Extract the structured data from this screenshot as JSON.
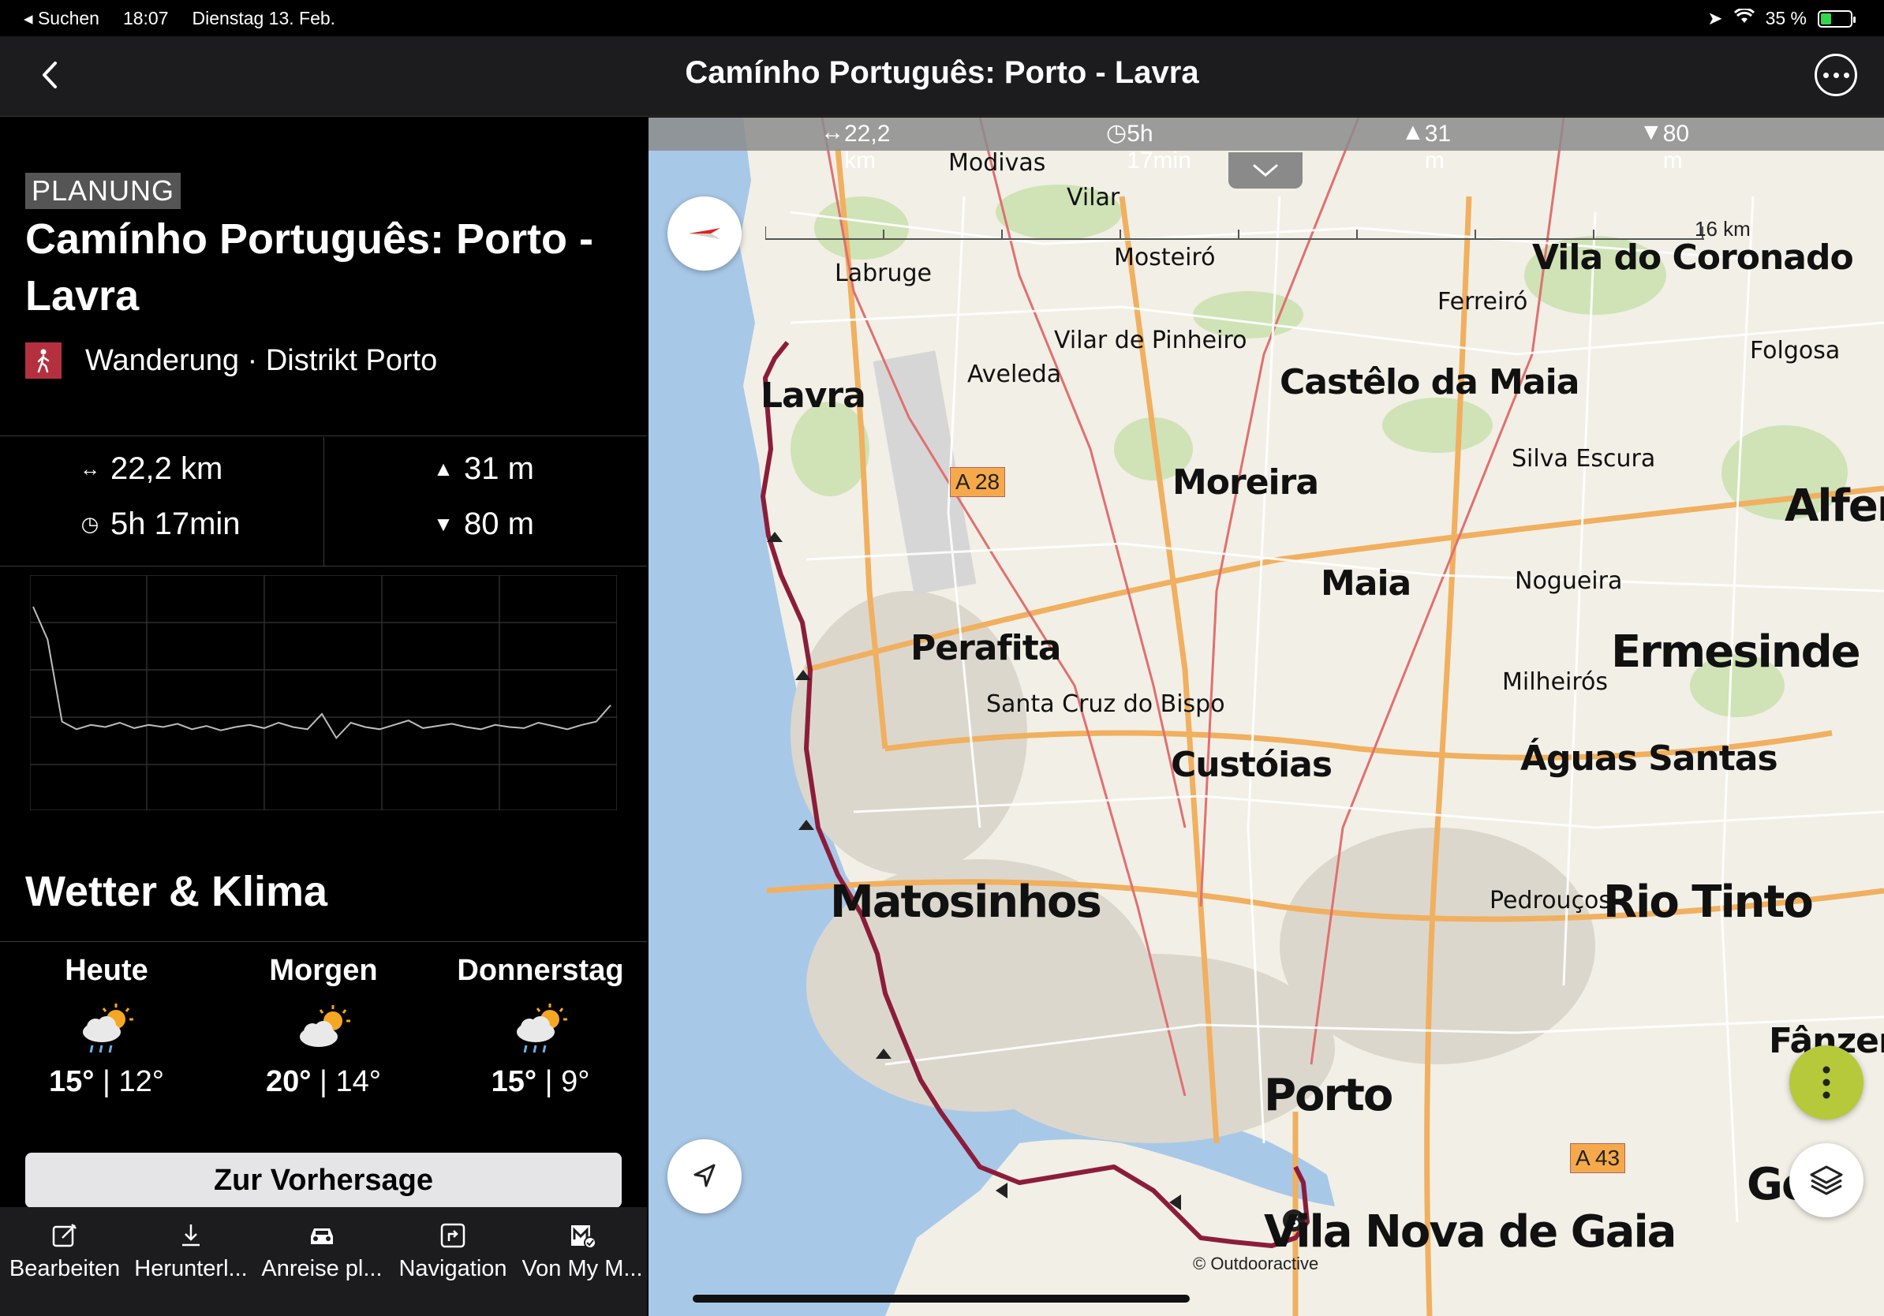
{
  "status": {
    "back_app": "Suchen",
    "time": "18:07",
    "date": "Dienstag 13. Feb.",
    "battery": "35 %",
    "battery_level": 0.35
  },
  "header": {
    "title": "Camínho Português: Porto - Lavra"
  },
  "tour": {
    "badge": "PLANUNG",
    "title": "Camínho Português: Porto - Lavra",
    "subtitle": "Wanderung · Distrikt Porto",
    "distance": "22,2 km",
    "duration": "5h 17min",
    "ascent": "31 m",
    "descent": "80 m"
  },
  "weather": {
    "heading": "Wetter & Klima",
    "days": [
      {
        "name": "Heute",
        "high": "15°",
        "low": "12°",
        "icon": "sun-cloud-rain-icon"
      },
      {
        "name": "Morgen",
        "high": "20°",
        "low": "14°",
        "icon": "sun-cloud-icon"
      },
      {
        "name": "Donnerstag",
        "high": "15°",
        "low": "9°",
        "icon": "sun-cloud-rain-icon"
      }
    ],
    "forecast_button": "Zur Vorhersage"
  },
  "toolbar": {
    "items": [
      {
        "label": "Bearbeiten",
        "icon": "edit-icon"
      },
      {
        "label": "Herunterl...",
        "icon": "download-icon"
      },
      {
        "label": "Anreise pl...",
        "icon": "car-icon"
      },
      {
        "label": "Navigation",
        "icon": "navigation-icon"
      },
      {
        "label": "Von My M...",
        "icon": "map-check-icon"
      }
    ]
  },
  "map": {
    "stats": {
      "distance": "22,2 km",
      "duration": "5h 17min",
      "ascent": "31 m",
      "descent": "80 m"
    },
    "scale": "16 km",
    "copyright": "© Outdooractive",
    "route_color": "#8b1d3a",
    "places": {
      "vila_nova_de_gaia": "Vila Nova de Gaia",
      "porto": "Porto",
      "matosinhos": "Matosinhos",
      "rio_tinto": "Rio Tinto",
      "ermesinde": "Ermesinde",
      "alfer": "Alfer",
      "maia": "Maia",
      "moreira": "Moreira",
      "custoias": "Custóias",
      "perafita": "Perafita",
      "lavra": "Lavra",
      "castelo_da_maia": "Castêlo da Maia",
      "vila_do_coronado": "Vila do Coronado",
      "aguas_santas": "Águas Santas",
      "gondomar": "Gon",
      "fanzeres": "Fânzere",
      "modivas": "Modivas",
      "vilar": "Vilar",
      "labruge": "Labruge",
      "mosteiro": "Mosteiró",
      "ferreiro": "Ferreiró",
      "vilar_de_pinheiro": "Vilar de Pinheiro",
      "aveleda": "Aveleda",
      "folgosa": "Folgosa",
      "silva_escura": "Silva Escura",
      "nogueira": "Nogueira",
      "milheiros": "Milheirós",
      "santa_cruz_do_bispo": "Santa Cruz do Bispo",
      "pedroucos": "Pedrouços"
    },
    "shields": {
      "a28": "A 28",
      "a43": "A 43"
    }
  },
  "elevation_profile": {
    "type": "line",
    "y": [
      150,
      120,
      45,
      38,
      42,
      40,
      44,
      39,
      42,
      40,
      43,
      38,
      41,
      37,
      40,
      42,
      39,
      44,
      40,
      38,
      52,
      30,
      44,
      40,
      38,
      42,
      46,
      39,
      41,
      43,
      40,
      38,
      42,
      40,
      39,
      44,
      41,
      38,
      42,
      45,
      60
    ]
  }
}
